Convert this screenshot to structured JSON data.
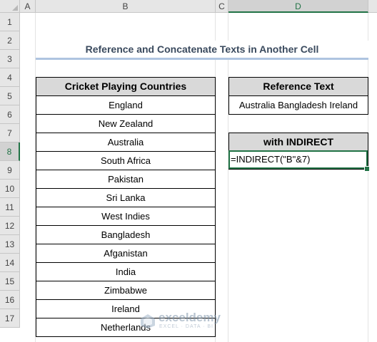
{
  "columns": [
    "A",
    "B",
    "C",
    "D"
  ],
  "rows": [
    "1",
    "2",
    "3",
    "4",
    "5",
    "6",
    "7",
    "8",
    "9",
    "10",
    "11",
    "12",
    "13",
    "14",
    "15",
    "16",
    "17"
  ],
  "title": "Reference and Concatenate Texts in Another Cell",
  "list_header": "Cricket Playing Countries",
  "countries": [
    "England",
    "New Zealand",
    "Australia",
    "South Africa",
    "Pakistan",
    "Sri Lanka",
    "West Indies",
    "Bangladesh",
    "Afganistan",
    "India",
    "Zimbabwe",
    "Ireland",
    "Netherlands"
  ],
  "reference_header": "Reference Text",
  "reference_value": "Australia Bangladesh Ireland",
  "indirect_header": "with INDIRECT",
  "formula": "=INDIRECT(\"B\"&7)",
  "watermark": {
    "name": "exceldemy",
    "tagline": "EXCEL · DATA · BI"
  },
  "colors": {
    "excel_green": "#217346",
    "header_fill": "#d9d9d9",
    "title_underline": "#aec4e0"
  }
}
